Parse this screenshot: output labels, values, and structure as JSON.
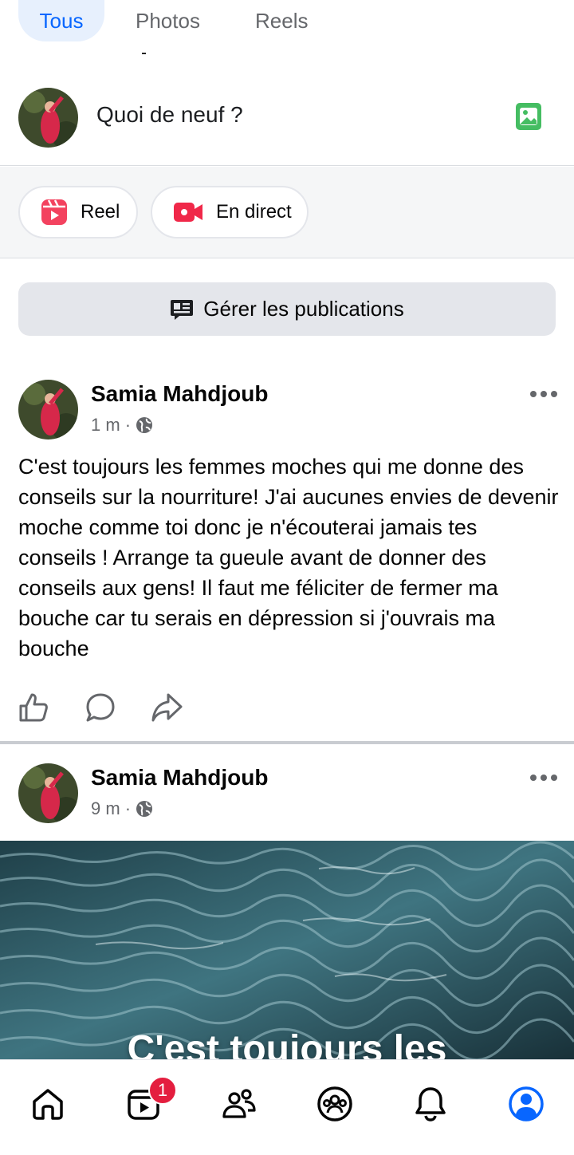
{
  "tabs": [
    {
      "label": "Tous",
      "active": true
    },
    {
      "label": "Photos",
      "active": false
    },
    {
      "label": "Reels",
      "active": false
    }
  ],
  "composer": {
    "placeholder": "Quoi de neuf ?",
    "photo_icon": "photo-icon"
  },
  "actions": {
    "reel_label": "Reel",
    "live_label": "En direct"
  },
  "manage": {
    "label": "Gérer les publications"
  },
  "posts": [
    {
      "author": "Samia Mahdjoub",
      "time": "1 m",
      "separator": "·",
      "audience_icon": "globe-icon",
      "text": "C'est toujours les femmes moches qui me donne des conseils sur la nourriture! J'ai aucunes envies de devenir moche comme toi donc je n'écouterai jamais tes conseils ! Arrange ta gueule avant de donner des conseils aux gens! Il faut me féliciter de fermer ma bouche car tu serais en dépression si j'ouvrais ma bouche"
    },
    {
      "author": "Samia Mahdjoub",
      "time": "9 m",
      "separator": "·",
      "audience_icon": "globe-icon",
      "media_overlay_text": "C'est toujours les"
    }
  ],
  "bottom_nav": {
    "items": [
      "home-icon",
      "video-icon",
      "friends-icon",
      "groups-icon",
      "notifications-icon",
      "profile-icon"
    ],
    "video_badge": "1"
  },
  "colors": {
    "accent": "#0866ff",
    "badge": "#e41e3f",
    "reel": "#f3425f",
    "photo": "#45bd62"
  }
}
